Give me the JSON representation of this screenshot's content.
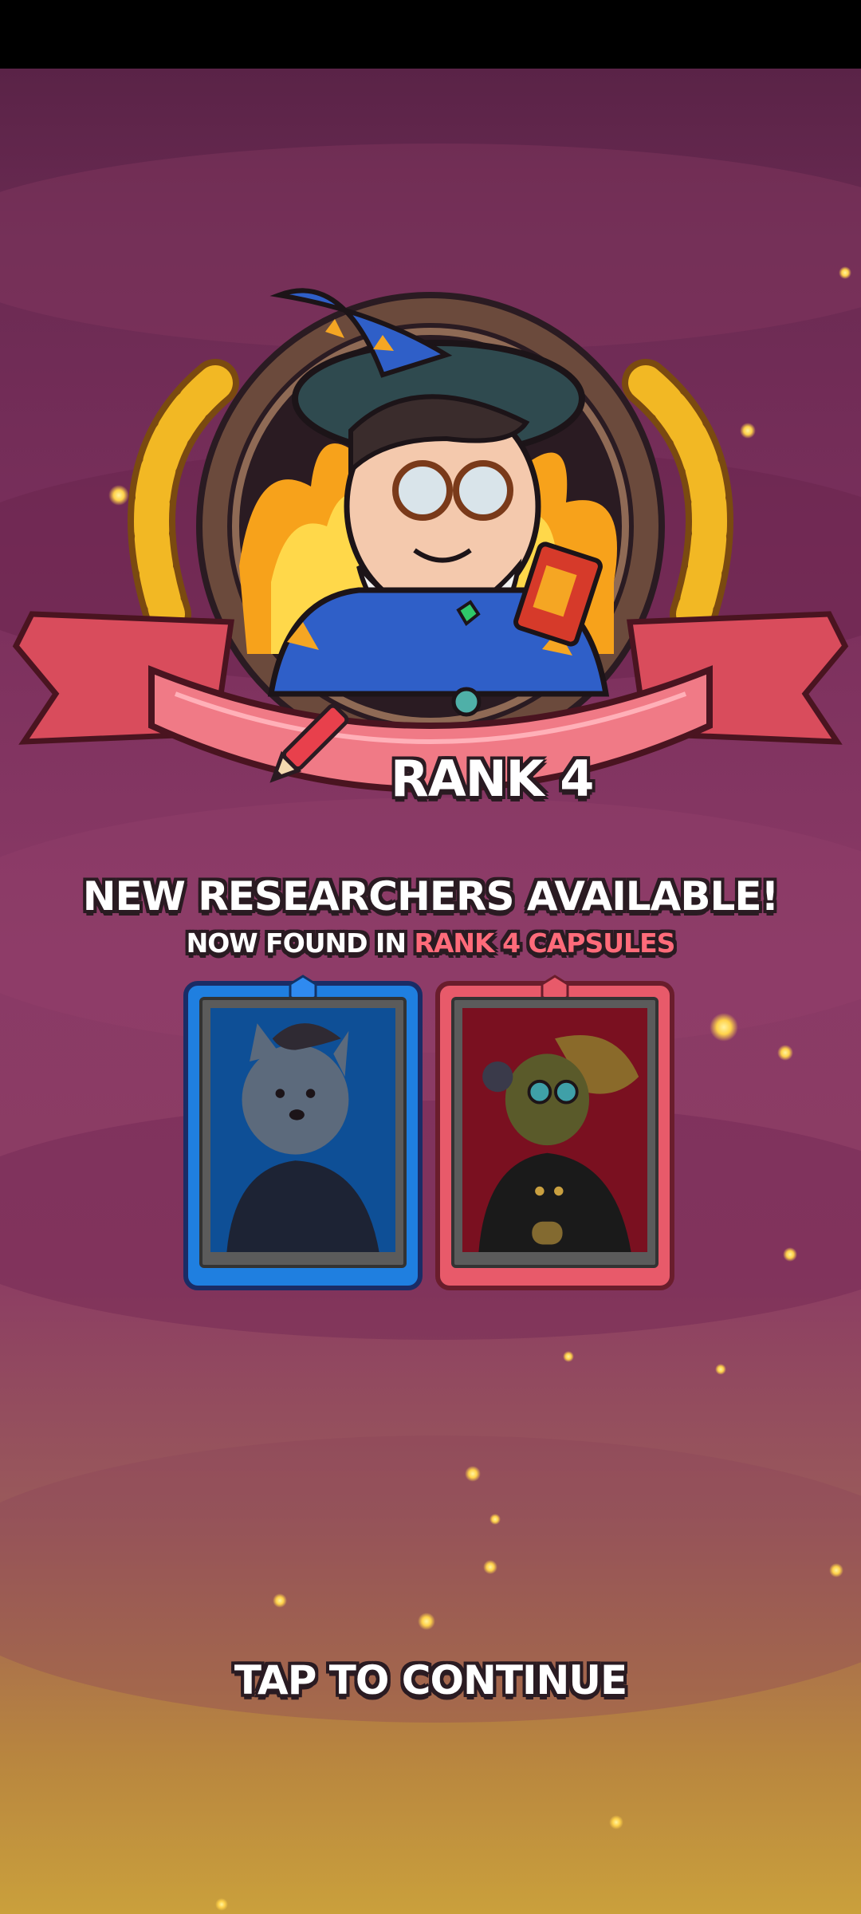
{
  "rank": {
    "label": "RANK 4"
  },
  "unlock": {
    "headline": "NEW RESEARCHERS AVAILABLE!",
    "subline_prefix": "NOW FOUND IN ",
    "subline_accent": "RANK 4 CAPSULES"
  },
  "cards": [
    {
      "name": "werewolf-researcher",
      "rarity_color": "#1f7fe0"
    },
    {
      "name": "goblin-researcher",
      "rarity_color": "#e85a6a"
    }
  ],
  "footer": {
    "continue_label": "TAP TO CONTINUE"
  },
  "colors": {
    "accent_pink": "#ff6b7a",
    "ribbon": "#f07a86",
    "gold": "#f2b824"
  }
}
